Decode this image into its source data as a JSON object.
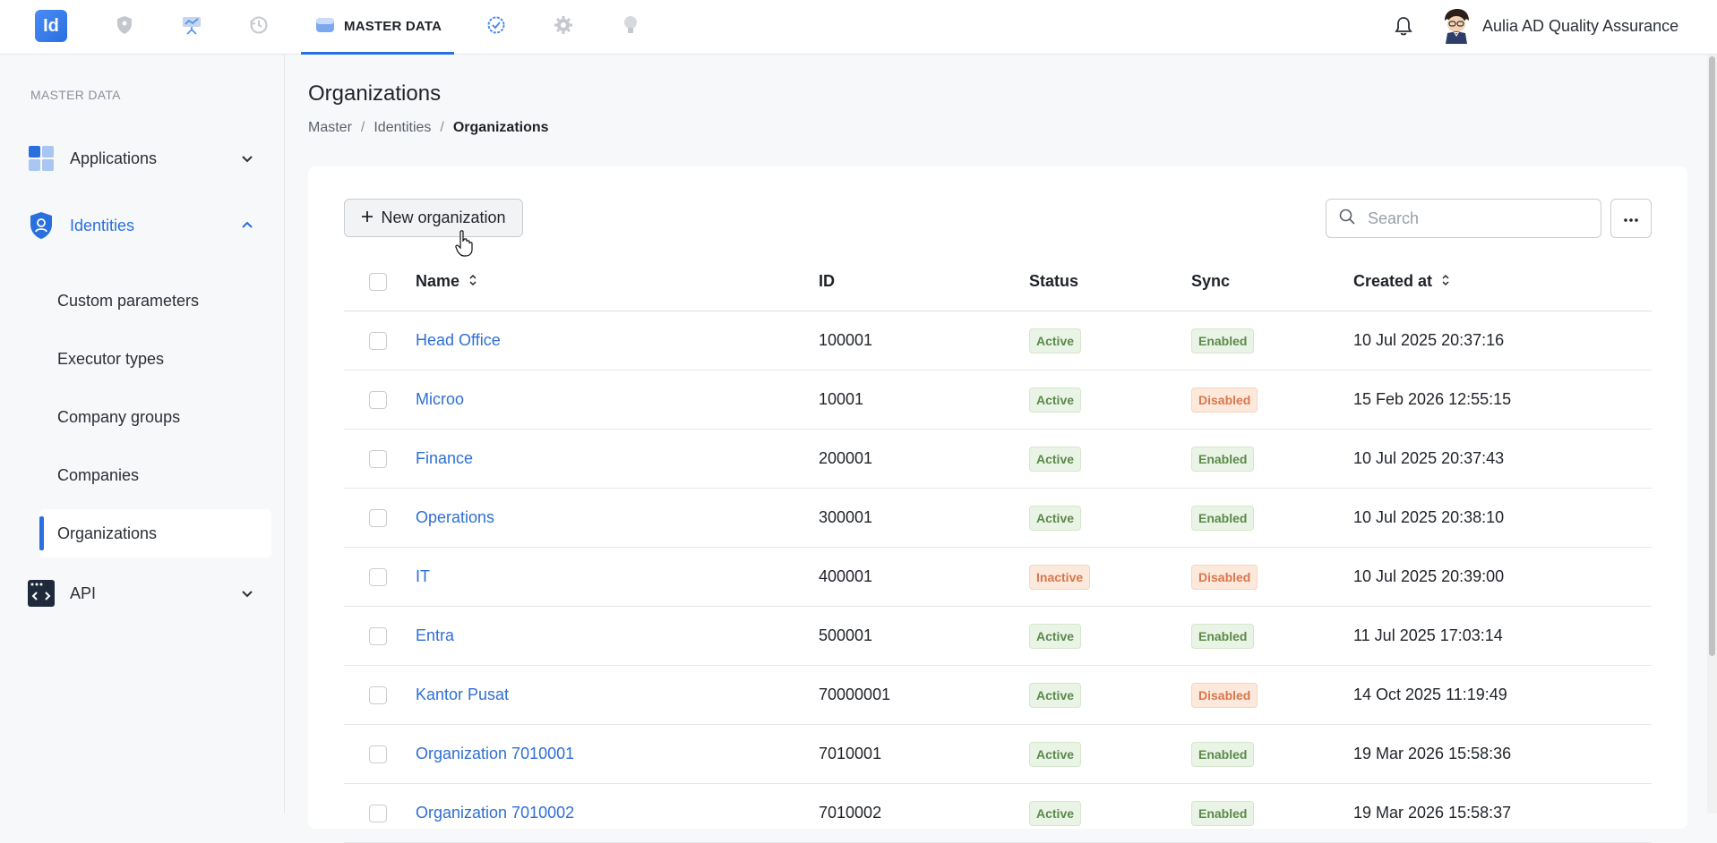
{
  "topbar": {
    "logo_text": "Id",
    "active_tab_label": "MASTER DATA",
    "user_name": "Aulia AD Quality Assurance",
    "icons": [
      "shield-icon",
      "presentation-icon",
      "history-icon",
      "database-icon",
      "check-circle-icon",
      "gear-icon",
      "lightbulb-icon",
      "bell-icon"
    ]
  },
  "sidebar": {
    "section_label": "MASTER DATA",
    "items": [
      {
        "label": "Applications",
        "icon": "apps-grid-icon"
      },
      {
        "label": "Identities",
        "icon": "identity-shield-icon"
      },
      {
        "label": "API",
        "icon": "code-window-icon"
      }
    ],
    "sub_items": [
      "Custom parameters",
      "Executor types",
      "Company groups",
      "Companies",
      "Organizations"
    ],
    "active_sub": "Organizations"
  },
  "page": {
    "title": "Organizations",
    "breadcrumb": [
      "Master",
      "Identities",
      "Organizations"
    ]
  },
  "toolbar": {
    "new_button_label": "New organization",
    "search_placeholder": "Search"
  },
  "table": {
    "headers": {
      "name": "Name",
      "id": "ID",
      "status": "Status",
      "sync": "Sync",
      "created": "Created at"
    },
    "rows": [
      {
        "name": "Head Office",
        "id": "100001",
        "status": "Active",
        "sync": "Enabled",
        "created": "10 Jul 2025 20:37:16"
      },
      {
        "name": "Microo",
        "id": "10001",
        "status": "Active",
        "sync": "Disabled",
        "created": "15 Feb 2026 12:55:15"
      },
      {
        "name": "Finance",
        "id": "200001",
        "status": "Active",
        "sync": "Enabled",
        "created": "10 Jul 2025 20:37:43"
      },
      {
        "name": "Operations",
        "id": "300001",
        "status": "Active",
        "sync": "Enabled",
        "created": "10 Jul 2025 20:38:10"
      },
      {
        "name": "IT",
        "id": "400001",
        "status": "Inactive",
        "sync": "Disabled",
        "created": "10 Jul 2025 20:39:00"
      },
      {
        "name": "Entra",
        "id": "500001",
        "status": "Active",
        "sync": "Enabled",
        "created": "11 Jul 2025 17:03:14"
      },
      {
        "name": "Kantor Pusat",
        "id": "70000001",
        "status": "Active",
        "sync": "Disabled",
        "created": "14 Oct 2025 11:19:49"
      },
      {
        "name": "Organization 7010001",
        "id": "7010001",
        "status": "Active",
        "sync": "Enabled",
        "created": "19 Mar 2026 15:58:36"
      },
      {
        "name": "Organization 7010002",
        "id": "7010002",
        "status": "Active",
        "sync": "Enabled",
        "created": "19 Mar 2026 15:58:37"
      }
    ]
  },
  "colors": {
    "accent": "#2a6fe0",
    "link": "#2f6fd6",
    "badge_green_text": "#5a8a4a",
    "badge_green_bg": "#eaf4e6",
    "badge_orange_text": "#d9764c",
    "badge_orange_bg": "#fde9dc"
  }
}
